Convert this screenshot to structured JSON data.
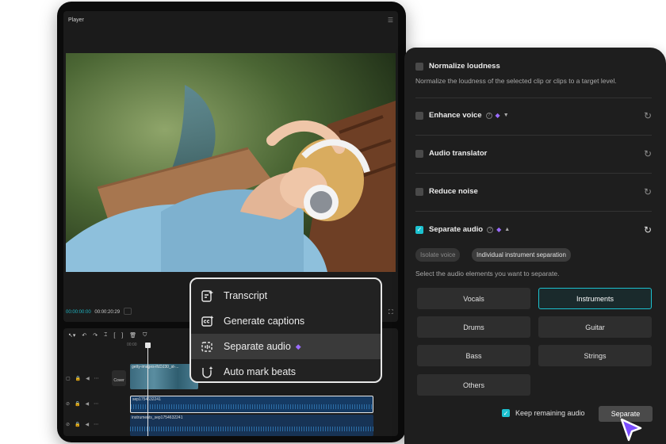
{
  "player": {
    "title": "Player",
    "timecode_current": "00:00:00:00",
    "timecode_total": "00:00:20:29"
  },
  "timeline": {
    "ruler_label": "00:00",
    "video_clip_label": "getty-images-ifcDJ30_st-...",
    "cover_label": "Cover",
    "audio_clip_1_label": "sep1754632241",
    "audio_clip_2_label": "instruments_sep1754632241"
  },
  "context_menu": {
    "items": [
      {
        "label": "Transcript",
        "icon": "transcript-icon"
      },
      {
        "label": "Generate captions",
        "icon": "captions-icon"
      },
      {
        "label": "Separate audio",
        "icon": "separate-audio-icon",
        "active": true,
        "premium": true
      },
      {
        "label": "Auto mark beats",
        "icon": "beats-icon"
      }
    ]
  },
  "audio_panel": {
    "normalize_label": "Normalize loudness",
    "normalize_desc": "Normalize the loudness of the selected clip or clips to a target level.",
    "enhance_label": "Enhance voice",
    "translator_label": "Audio translator",
    "reduce_noise_label": "Reduce noise",
    "separate_label": "Separate audio",
    "separate_checked": true,
    "modes": [
      {
        "label": "Isolate voice",
        "active": false
      },
      {
        "label": "Individual instrument separation",
        "active": true
      }
    ],
    "select_hint": "Select the audio elements you want to separate.",
    "elements": [
      {
        "label": "Vocals",
        "selected": false
      },
      {
        "label": "Instruments",
        "selected": true
      },
      {
        "label": "Drums",
        "selected": false
      },
      {
        "label": "Guitar",
        "selected": false
      },
      {
        "label": "Bass",
        "selected": false
      },
      {
        "label": "Strings",
        "selected": false
      },
      {
        "label": "Others",
        "selected": false
      }
    ],
    "keep_remaining_label": "Keep remaining audio",
    "keep_remaining_checked": true,
    "separate_button_label": "Separate"
  },
  "colors": {
    "accent": "#1cc2d0",
    "premium": "#9b6cff",
    "panel_bg": "#1e1e1e",
    "editor_bg": "#0b0b0b"
  }
}
